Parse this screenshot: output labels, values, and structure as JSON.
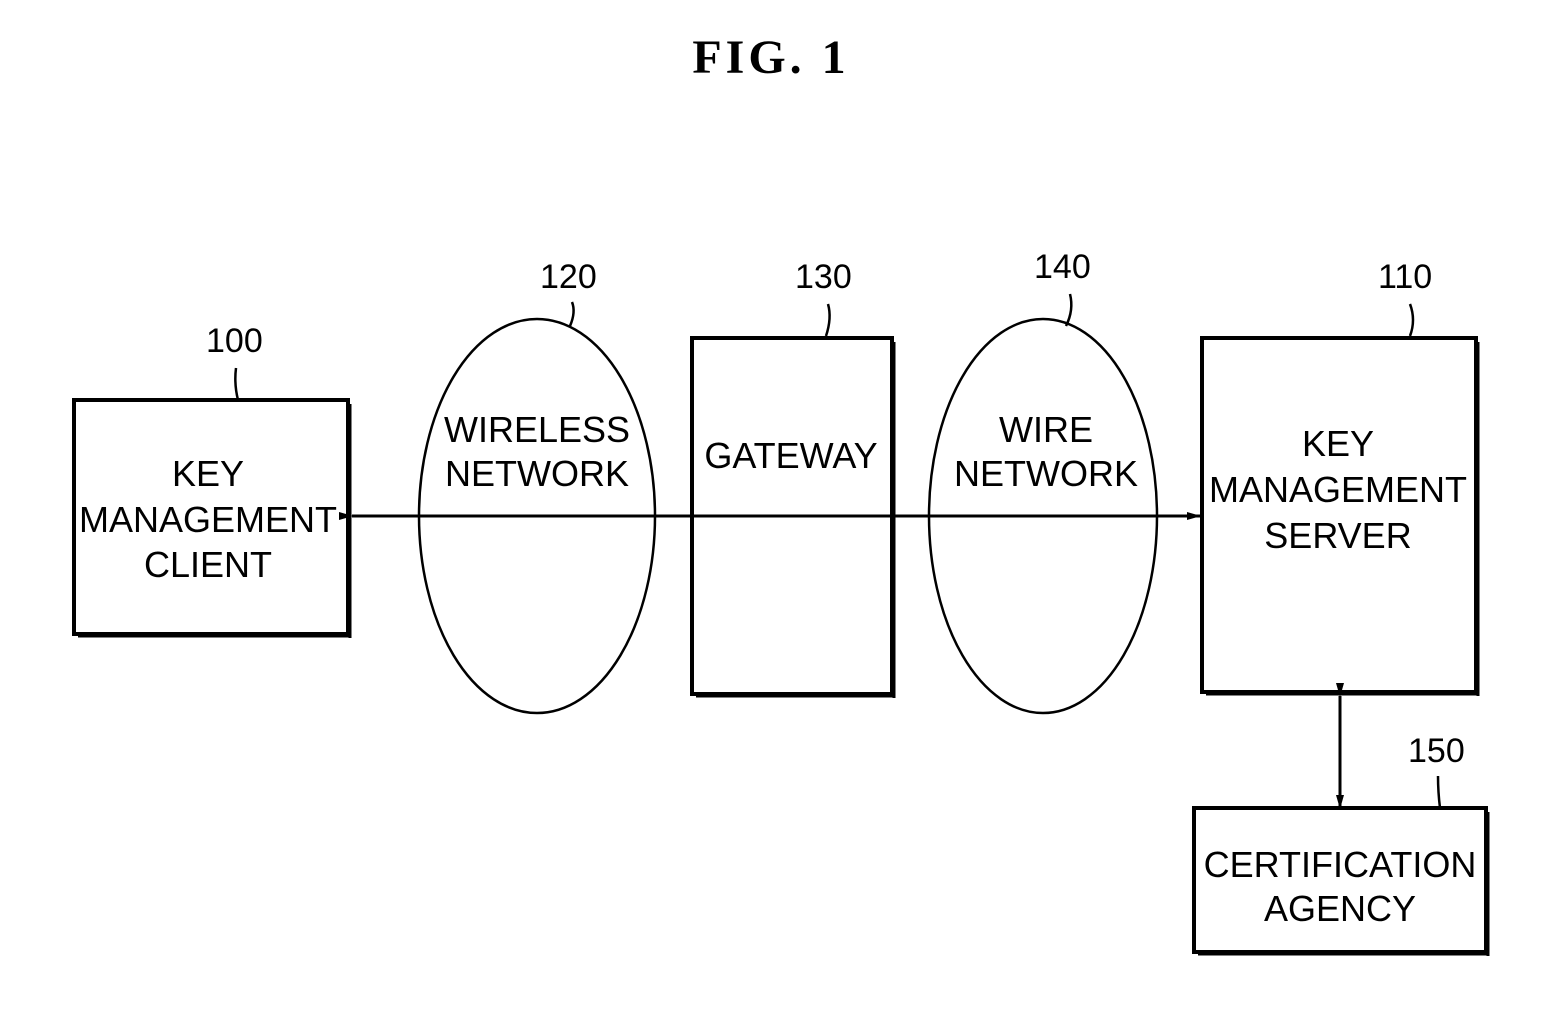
{
  "figure": {
    "title": "FIG.  1"
  },
  "nodes": {
    "client": {
      "ref": "100",
      "lines": [
        "KEY",
        "MANAGEMENT",
        "CLIENT"
      ]
    },
    "wireless": {
      "ref": "120",
      "lines": [
        "WIRELESS",
        "NETWORK"
      ]
    },
    "gateway": {
      "ref": "130",
      "lines": [
        "GATEWAY"
      ]
    },
    "wire": {
      "ref": "140",
      "lines": [
        "WIRE",
        "NETWORK"
      ]
    },
    "server": {
      "ref": "110",
      "lines": [
        "KEY",
        "MANAGEMENT",
        "SERVER"
      ]
    },
    "ca": {
      "ref": "150",
      "lines": [
        "CERTIFICATION",
        "AGENCY"
      ]
    }
  },
  "edges": [
    {
      "from": "client",
      "to": "server",
      "type": "bidirectional",
      "via": [
        "wireless",
        "gateway",
        "wire"
      ]
    },
    {
      "from": "server",
      "to": "ca",
      "type": "bidirectional"
    }
  ]
}
